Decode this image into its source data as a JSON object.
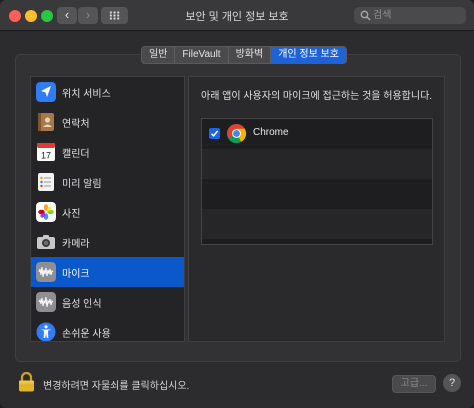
{
  "window": {
    "title": "보안 및 개인 정보 보호",
    "back_glyph": "‹",
    "forward_glyph": "›"
  },
  "search": {
    "placeholder": "검색",
    "value": ""
  },
  "tabs": [
    {
      "label": "일반",
      "active": false
    },
    {
      "label": "FileVault",
      "active": false
    },
    {
      "label": "방화벽",
      "active": false
    },
    {
      "label": "개인 정보 보호",
      "active": true
    }
  ],
  "sidebar": {
    "items": [
      {
        "label": "위치 서비스",
        "icon": "location-arrow-icon",
        "selected": false
      },
      {
        "label": "연락처",
        "icon": "contacts-book-icon",
        "selected": false
      },
      {
        "label": "캘린더",
        "icon": "calendar-icon",
        "selected": false,
        "calendar_day": "17"
      },
      {
        "label": "미리 알림",
        "icon": "reminders-icon",
        "selected": false
      },
      {
        "label": "사진",
        "icon": "photos-icon",
        "selected": false
      },
      {
        "label": "카메라",
        "icon": "camera-icon",
        "selected": false
      },
      {
        "label": "마이크",
        "icon": "microphone-waveform-icon",
        "selected": true
      },
      {
        "label": "음성 인식",
        "icon": "speech-recognition-icon",
        "selected": false
      },
      {
        "label": "손쉬운 사용",
        "icon": "accessibility-icon",
        "selected": false
      }
    ]
  },
  "detail": {
    "description": "아래 앱이 사용자의 마이크에 접근하는 것을 허용합니다.",
    "apps": [
      {
        "name": "Chrome",
        "checked": true,
        "icon": "chrome-icon"
      }
    ]
  },
  "footer": {
    "lock_text": "변경하려면 자물쇠를 클릭하십시오.",
    "advanced_label": "고급...",
    "help_label": "?"
  },
  "colors": {
    "accent": "#0a58ca",
    "active_tab": "#1d62d6",
    "window_bg": "#2c2c2e"
  }
}
